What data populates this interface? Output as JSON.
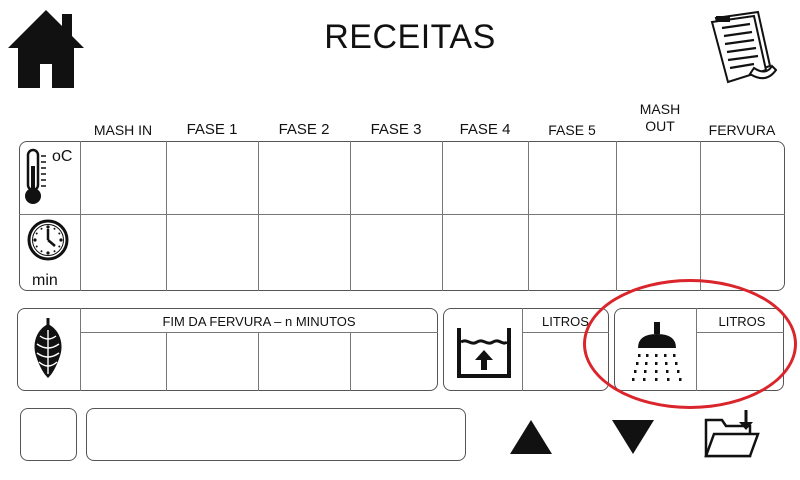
{
  "title": "RECEITAS",
  "columns": [
    "MASH IN",
    "FASE 1",
    "FASE 2",
    "FASE 3",
    "FASE 4",
    "FASE 5",
    "MASH OUT",
    "FERVURA"
  ],
  "temp_unit": "oC",
  "time_unit": "min",
  "hops_label": "FIM DA FERVURA – n MINUTOS",
  "water_label": "LITROS",
  "sparge_label": "LITROS",
  "icons": {
    "home": "home-icon",
    "recipe": "recipe-document-icon",
    "thermometer": "thermometer-icon",
    "clock": "clock-icon",
    "hops": "hops-icon",
    "water_tank": "water-tank-icon",
    "shower": "shower-icon",
    "up": "arrow-up-icon",
    "down": "arrow-down-icon",
    "folder": "folder-download-icon"
  },
  "colors": {
    "highlight": "#d9252b",
    "border": "#555555"
  }
}
